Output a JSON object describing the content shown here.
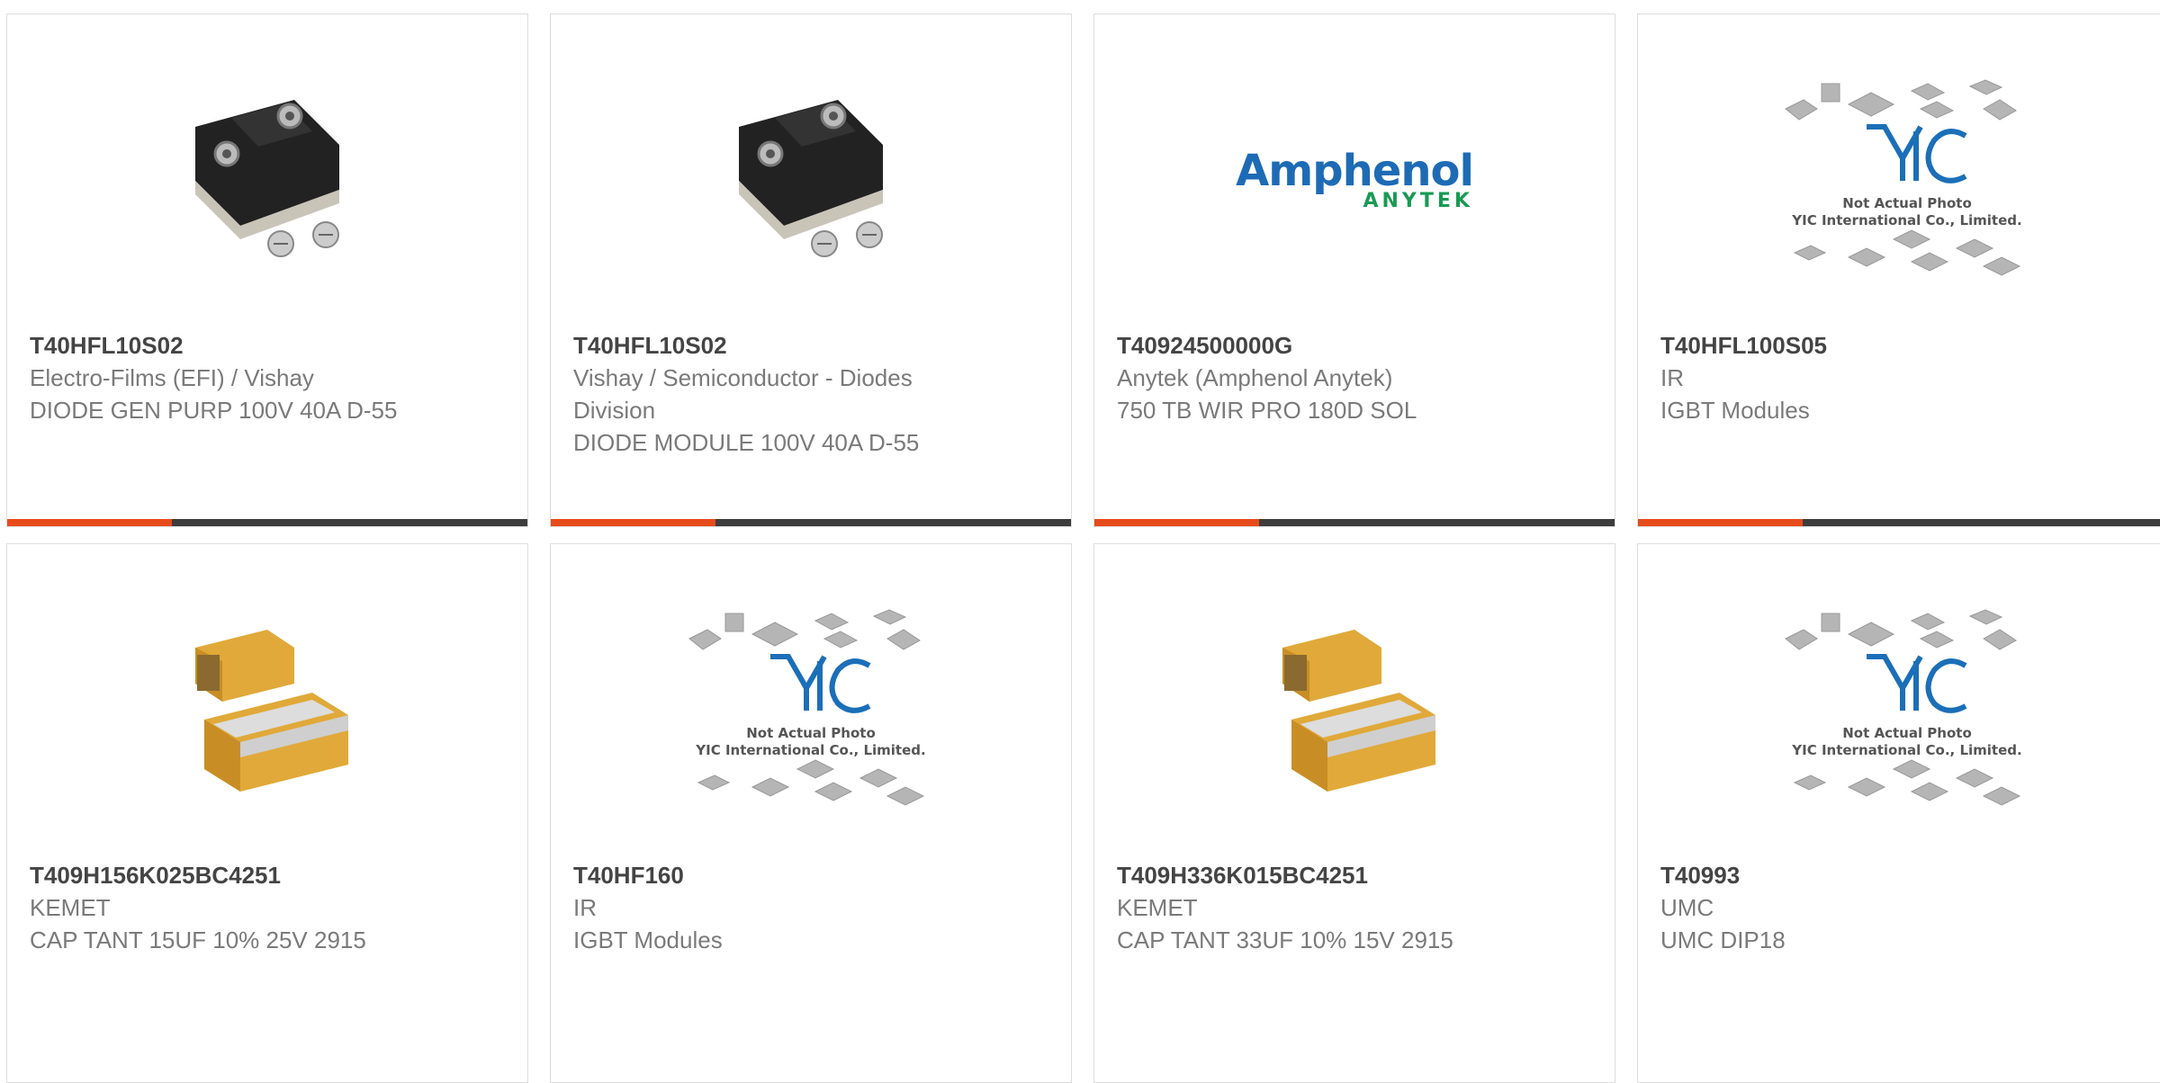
{
  "products": [
    {
      "part_number": "T40HFL10S02",
      "manufacturer": "Electro-Films (EFI) / Vishay",
      "description": "DIODE GEN PURP 100V 40A D-55",
      "image": "diode-module-photo"
    },
    {
      "part_number": "T40HFL10S02",
      "manufacturer": "Vishay / Semiconductor - Diodes Division",
      "description": "DIODE MODULE 100V 40A D-55",
      "image": "diode-module-photo"
    },
    {
      "part_number": "T40924500000G",
      "manufacturer": "Anytek (Amphenol Anytek)",
      "description": "750 TB WIR PRO 180D SOL",
      "image": "amphenol-anytek-logo"
    },
    {
      "part_number": "T40HFL100S05",
      "manufacturer": "IR",
      "description": "IGBT Modules",
      "image": "not-actual-photo-placeholder"
    },
    {
      "part_number": "T409H156K025BC4251",
      "manufacturer": "KEMET",
      "description": "CAP TANT 15UF 10% 25V 2915",
      "image": "tantalum-capacitor-photo"
    },
    {
      "part_number": "T40HF160",
      "manufacturer": "IR",
      "description": "IGBT Modules",
      "image": "not-actual-photo-placeholder"
    },
    {
      "part_number": "T409H336K015BC4251",
      "manufacturer": "KEMET",
      "description": "CAP TANT 33UF 10% 15V 2915",
      "image": "tantalum-capacitor-photo"
    },
    {
      "part_number": "T40993",
      "manufacturer": "UMC",
      "description": "UMC DIP18",
      "image": "not-actual-photo-placeholder"
    }
  ],
  "logo": {
    "amphenol_top": "Amphenol",
    "amphenol_bottom": "ANYTEK"
  },
  "placeholder": {
    "brand": "YIC",
    "line1": "Not Actual Photo",
    "line2": "YIC International Co., Limited."
  },
  "colors": {
    "accent": "#e84b1b",
    "bar": "#3d3d3d",
    "amphenol_blue": "#1e6bb5",
    "anytek_green": "#1a9a54",
    "yic_blue": "#1b6fb8"
  }
}
